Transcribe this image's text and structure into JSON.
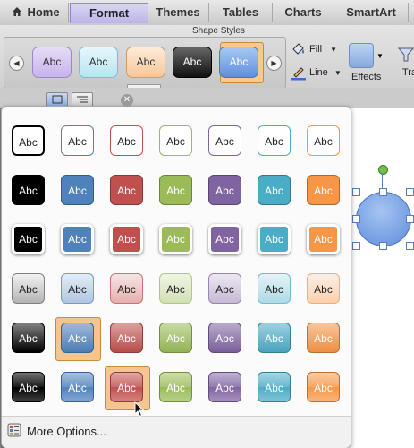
{
  "tabs": [
    {
      "label": "Home",
      "icon": "home-icon",
      "active": false
    },
    {
      "label": "Format",
      "active": true
    },
    {
      "label": "Themes",
      "active": false
    },
    {
      "label": "Tables",
      "active": false
    },
    {
      "label": "Charts",
      "active": false
    },
    {
      "label": "SmartArt",
      "active": false
    }
  ],
  "ribbon": {
    "group_title": "Shape Styles",
    "swatch_label": "Abc",
    "fill_label": "Fill",
    "line_label": "Line",
    "effects_label": "Effects",
    "truncated_label": "Tra",
    "swatches": [
      {
        "color_top": "#e6dcf7",
        "color_bottom": "#c7b3ec",
        "text": "#333333",
        "border": "#9c86c8"
      },
      {
        "color_top": "#e5f7fb",
        "color_bottom": "#b8e5f0",
        "text": "#333333",
        "border": "#7dbcd0"
      },
      {
        "color_top": "#fdebd8",
        "color_bottom": "#f6c79a",
        "text": "#333333",
        "border": "#d69a62"
      },
      {
        "color_top": "#666666",
        "color_bottom": "#111111",
        "text": "#ffffff",
        "border": "#000000"
      },
      {
        "color_top": "#a8c8f5",
        "color_bottom": "#5f90dc",
        "text": "#ffffff",
        "border": "#4876c0",
        "selected": true
      }
    ]
  },
  "gallery": {
    "swatch_label": "Abc",
    "more_options_label": "More Options...",
    "accent_colors": [
      "#000000",
      "#4f81bd",
      "#c0504d",
      "#9bbb59",
      "#8064a2",
      "#4bacc6",
      "#f79646"
    ],
    "rows": [
      {
        "style": "outline"
      },
      {
        "style": "solid"
      },
      {
        "style": "solid-white-border"
      },
      {
        "style": "light-gradient"
      },
      {
        "style": "intense-gradient"
      },
      {
        "style": "glossy"
      }
    ],
    "selected": [
      {
        "row": 4,
        "col": 1
      },
      {
        "row": 5,
        "col": 2
      }
    ]
  }
}
